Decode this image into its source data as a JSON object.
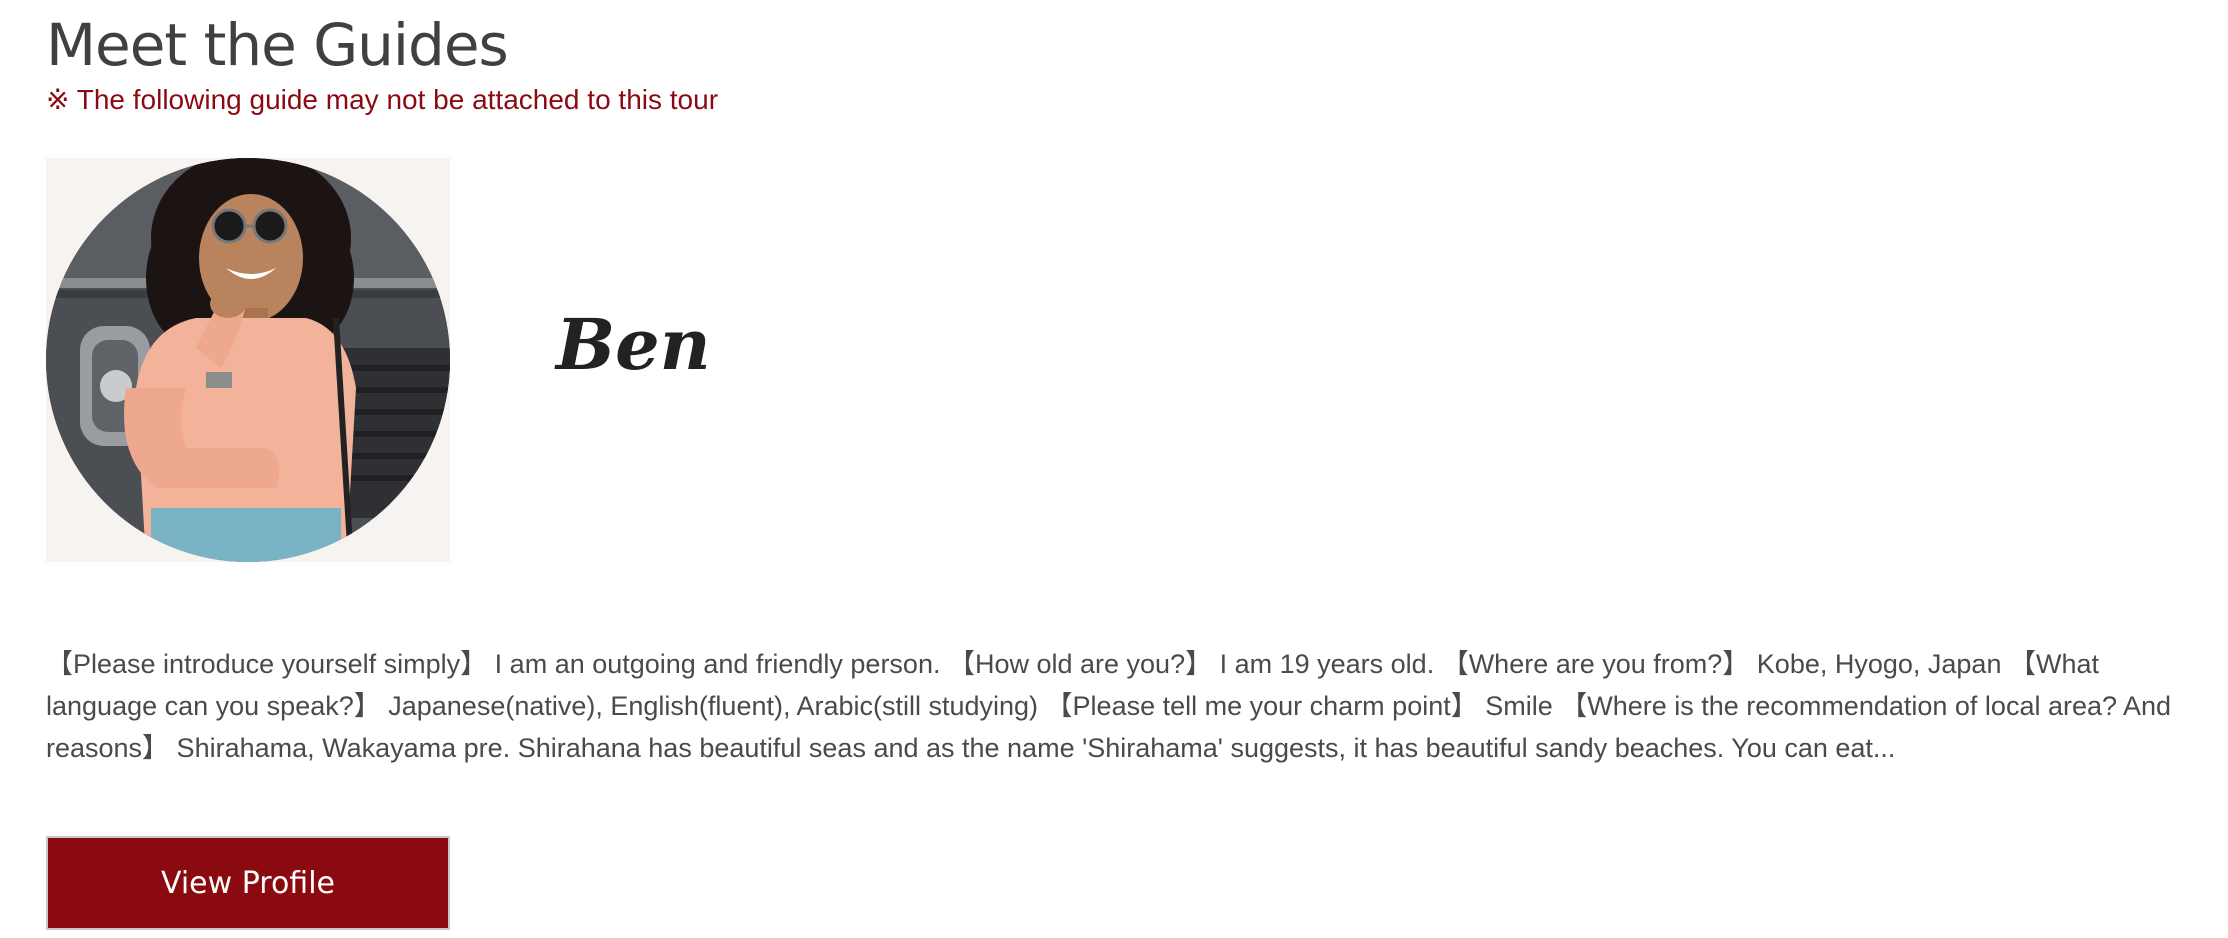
{
  "section": {
    "title": "Meet the Guides",
    "notice": "※ The following guide may not be attached to this tour"
  },
  "guide": {
    "name": "Ben",
    "photo_description_icon": "guide-photo",
    "bio": "【Please introduce yourself simply】 I am an outgoing and friendly person. 【How old are you?】 I am 19 years old. 【Where are you from?】 Kobe, Hyogo, Japan 【What language can you speak?】 Japanese(native), English(fluent), Arabic(still studying) 【Please tell me your charm point】 Smile 【Where is the recommendation of local area? And reasons】 Shirahama, Wakayama pre. Shirahana has beautiful seas and as the name 'Shirahama' suggests, it has beautiful sandy beaches. You can eat...",
    "button_label": "View Profile"
  },
  "colors": {
    "accent": "#8b0a0f",
    "notice": "#8b0a12",
    "title": "#404040"
  }
}
